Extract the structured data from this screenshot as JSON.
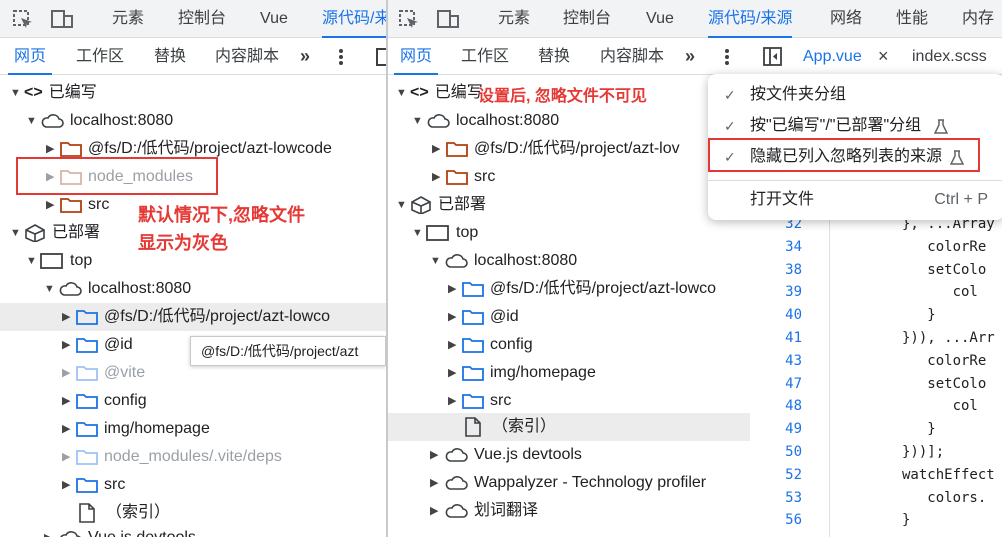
{
  "left": {
    "topbar": {
      "elements_tab": "元素",
      "console_tab": "控制台",
      "vue_tab": "Vue",
      "sources_tab": "源代码/来"
    },
    "subbar": {
      "page_tab": "网页",
      "workspace_tab": "工作区",
      "overrides_tab": "替换",
      "content_scripts_tab": "内容脚本",
      "more": "»"
    },
    "tree": {
      "authored": "已编写",
      "localhost_a": "localhost:8080",
      "fs_a": "@fs/D:/低代码/project/azt-lowcode",
      "node_modules": "node_modules",
      "src_a": "src",
      "deployed": "已部署",
      "top": "top",
      "localhost_b": "localhost:8080",
      "fs_b": "@fs/D:/低代码/project/azt-lowco",
      "id": "@id",
      "vite": "@vite",
      "config": "config",
      "img": "img/homepage",
      "node_modules_deps": "node_modules/.vite/deps",
      "src_b": "src",
      "index": "（索引）",
      "vue_devtools": "Vue.js devtools"
    },
    "annotation_line1": "默认情况下,忽略文件",
    "annotation_line2": "显示为灰色",
    "tooltip": "@fs/D:/低代码/project/azt"
  },
  "right": {
    "topbar": {
      "elements_tab": "元素",
      "console_tab": "控制台",
      "vue_tab": "Vue",
      "sources_tab": "源代码/来源",
      "network_tab": "网络",
      "performance_tab": "性能",
      "memory_tab": "内存"
    },
    "subbar": {
      "page_tab": "网页",
      "workspace_tab": "工作区",
      "overrides_tab": "替换",
      "content_scripts_tab": "内容脚本",
      "more": "»",
      "file_tab_1": "App.vue",
      "close": "×",
      "file_tab_2": "index.scss"
    },
    "tree": {
      "authored": "已编写",
      "localhost_a": "localhost:8080",
      "fs_a": "@fs/D:/低代码/project/azt-lov",
      "src_a": "src",
      "deployed": "已部署",
      "top": "top",
      "localhost_b": "localhost:8080",
      "fs_b": "@fs/D:/低代码/project/azt-lowco",
      "id": "@id",
      "config": "config",
      "img": "img/homepage",
      "src_b": "src",
      "index": "（索引）",
      "vue_devtools": "Vue.js devtools",
      "wappalyzer": "Wappalyzer - Technology profiler",
      "translate": "划词翻译"
    },
    "annotation": "设置后, 忽略文件不可见",
    "menu": {
      "group_by_folder": "按文件夹分组",
      "group_by_authored": "按\"已编写\"/\"已部署\"分组",
      "hide_ignored": "隐藏已列入忽略列表的来源",
      "open_file": "打开文件",
      "open_file_shortcut": "Ctrl + P"
    },
    "code": {
      "line_numbers": [
        "32",
        "34",
        "38",
        "39",
        "40",
        "41",
        "43",
        "47",
        "48",
        "49",
        "50",
        "52",
        "53",
        "56"
      ],
      "lines": [
        "}, ...Array",
        "   colorRe",
        "   setColo",
        "      col",
        "   }",
        "})), ...Arr",
        "   colorRe",
        "   setColo",
        "      col",
        "   }",
        "}))];",
        "watchEffect",
        "   colors.",
        "}"
      ]
    }
  },
  "colors": {
    "accent": "#1a73e8",
    "folder_blue": "#1a73e8",
    "folder_orange": "#b0400f",
    "folder_grey": "#b0b4b8",
    "annotation_red": "#e53935"
  }
}
